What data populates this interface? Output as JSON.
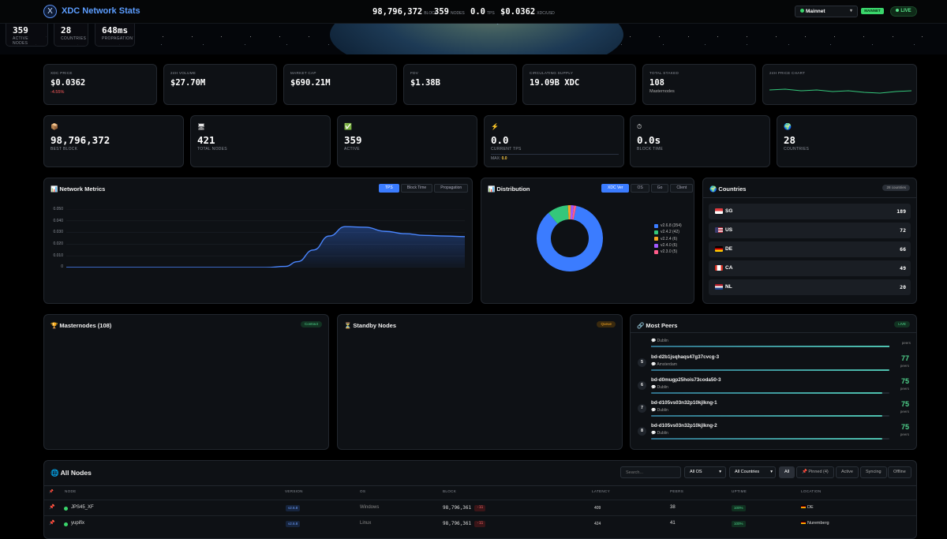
{
  "header": {
    "logo_letter": "X",
    "brand": "XDC Network Stats",
    "stats": [
      {
        "value": "98,796,372",
        "unit": "BLOCK"
      },
      {
        "value": "359",
        "unit": "NODES"
      },
      {
        "value": "0.0",
        "unit": "TPS"
      },
      {
        "value": "$0.0362",
        "unit": "XDC/USD"
      }
    ],
    "network_select": "Mainnet",
    "network_badge": "MAINNET",
    "live": "LIVE"
  },
  "hero_stats": [
    {
      "value": "359",
      "label": "ACTIVE NODES"
    },
    {
      "value": "28",
      "label": "COUNTRIES"
    },
    {
      "value": "648ms",
      "label": "PROPAGATION"
    }
  ],
  "market": [
    {
      "label": "XDC PRICE",
      "value": "$0.0362",
      "sub": "-4.55%"
    },
    {
      "label": "24H VOLUME",
      "value": "$27.70M"
    },
    {
      "label": "MARKET CAP",
      "value": "$690.21M"
    },
    {
      "label": "FDV",
      "value": "$1.38B"
    },
    {
      "label": "CIRCULATING SUPPLY",
      "value": "19.09B XDC"
    },
    {
      "label": "TOTAL STAKED",
      "value": "108",
      "sub": "Masternodes"
    },
    {
      "label": "24H PRICE CHART"
    }
  ],
  "block_stats": [
    {
      "icon": "📦",
      "icon_name": "box-icon",
      "value": "98,796,372",
      "label": "BEST BLOCK"
    },
    {
      "icon": "🖥",
      "icon_name": "monitor-icon",
      "value": "421",
      "label": "TOTAL NODES"
    },
    {
      "icon": "✅",
      "icon_name": "check-icon",
      "value": "359",
      "label": "ACTIVE"
    },
    {
      "icon": "⚡",
      "icon_name": "lightning-icon",
      "value": "0.0",
      "label": "CURRENT TPS",
      "max_label": "MAX:",
      "max_value": "0.0"
    },
    {
      "icon": "⏱",
      "icon_name": "stopwatch-icon",
      "value": "0.0s",
      "label": "BLOCK TIME"
    },
    {
      "icon": "🌍",
      "icon_name": "globe-icon",
      "value": "28",
      "label": "COUNTRIES"
    }
  ],
  "network_metrics": {
    "title": "📊 Network Metrics",
    "tabs": [
      "TPS",
      "Block Time",
      "Propagation"
    ],
    "active_tab": "TPS"
  },
  "chart_data": {
    "type": "area",
    "title": "",
    "xlabel": "",
    "ylabel": "",
    "yticks": [
      "0.050",
      "0.040",
      "0.030",
      "0.020",
      "0.010",
      "0"
    ],
    "ylim": [
      0,
      0.05
    ],
    "grid": true,
    "x": [
      0,
      10,
      20,
      30,
      40,
      50,
      55,
      58,
      62,
      66,
      70,
      75,
      80,
      85,
      90,
      95,
      100
    ],
    "values": [
      0,
      0,
      0,
      0,
      0,
      0,
      0.001,
      0.005,
      0.015,
      0.027,
      0.035,
      0.0345,
      0.031,
      0.029,
      0.0275,
      0.027,
      0.0265
    ]
  },
  "distribution": {
    "title": "📊 Distribution",
    "tabs": [
      "XDC Ver",
      "OS",
      "Go",
      "Client"
    ],
    "active_tab": "XDC Ver",
    "slices": [
      {
        "label": "v2.6.8 (354)",
        "value": 354,
        "color": "#3b7cff"
      },
      {
        "label": "v2.4.2 (42)",
        "value": 42,
        "color": "#34c77b"
      },
      {
        "label": "v2.2.4 (6)",
        "value": 6,
        "color": "#f5a623"
      },
      {
        "label": "v2.4.0 (6)",
        "value": 6,
        "color": "#a259ff"
      },
      {
        "label": "v2.3.0 (5)",
        "value": 5,
        "color": "#ff5c8a"
      }
    ]
  },
  "countries": {
    "title": "🌍 Countries",
    "badge": "28 countries",
    "rows": [
      {
        "code": "SG",
        "count": "189",
        "flag": [
          "#e03a3e",
          "#ffffff"
        ]
      },
      {
        "code": "US",
        "count": "72",
        "flag": [
          "#3c3b6e",
          "#b22234"
        ]
      },
      {
        "code": "DE",
        "count": "66",
        "flag": [
          "#000000",
          "#dd0000"
        ]
      },
      {
        "code": "CA",
        "count": "49",
        "flag": [
          "#d52b1e",
          "#ffffff"
        ]
      },
      {
        "code": "NL",
        "count": "20",
        "flag": [
          "#ae1c28",
          "#21468b"
        ]
      }
    ]
  },
  "masternodes": {
    "title": "🏆 Masternodes (108)",
    "badge": "Contract"
  },
  "standby": {
    "title": "⏳ Standby Nodes",
    "badge": "Queue"
  },
  "most_peers": {
    "title": "🔗 Most Peers",
    "badge": "LIVE",
    "peers_label": "peers",
    "rows": [
      {
        "rank": "5",
        "name": "bd-d2b1jsqhaqs47g37cvcg-3",
        "location": "Amsterdam",
        "peers": "77",
        "fill": 1.0
      },
      {
        "rank": "6",
        "name": "bd-d0mugp25hois73coda50-3",
        "location": "Dublin",
        "peers": "75",
        "fill": 0.97
      },
      {
        "rank": "7",
        "name": "bd-d105vs03n32p10kjlkng-1",
        "location": "Dublin",
        "peers": "75",
        "fill": 0.97
      },
      {
        "rank": "8",
        "name": "bd-d105vs03n32p10kjlkng-2",
        "location": "Dublin",
        "peers": "75",
        "fill": 0.97
      }
    ],
    "partial_location": "Dublin"
  },
  "all_nodes": {
    "title": "🌐 All Nodes",
    "search_placeholder": "Search...",
    "os_filter": "All OS",
    "country_filter": "All Countries",
    "filters": [
      "All",
      "📌 Pinned (4)",
      "Active",
      "Syncing",
      "Offline"
    ],
    "columns": [
      "📌",
      "NODE",
      "VERSION",
      "OS",
      "BLOCK",
      "LATENCY",
      "PEERS",
      "UPTIME",
      "LOCATION"
    ],
    "rows": [
      {
        "name": "JPS45_XF",
        "version": "v2.6.8",
        "os": "Windows",
        "block": "98,796,361",
        "delta": "-11",
        "latency": "409",
        "peers": "38",
        "uptime": "100%",
        "location": "DE"
      },
      {
        "name": "yupifix",
        "version": "v2.6.8",
        "os": "Linux",
        "block": "98,796,361",
        "delta": "-11",
        "latency": "424",
        "peers": "41",
        "uptime": "100%",
        "location": "Nuremberg"
      }
    ]
  }
}
